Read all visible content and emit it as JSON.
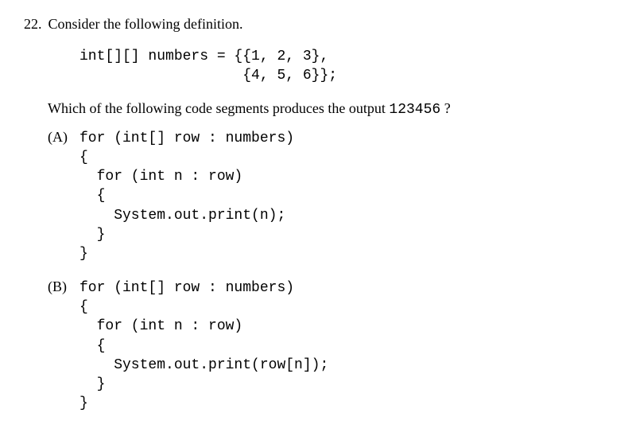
{
  "question": {
    "number": "22.",
    "stem": "Consider the following definition.",
    "code_line1": "int[][] numbers = {{1, 2, 3},",
    "code_line2": "                   {4, 5, 6}};",
    "prompt_pre": "Which of the following code segments produces the output  ",
    "prompt_code": "123456",
    "prompt_post": " ?"
  },
  "options": {
    "A": {
      "label": "(A)",
      "l1": "for (int[] row : numbers)",
      "l2": "{",
      "l3": "  for (int n : row)",
      "l4": "  {",
      "l5": "    System.out.print(n);",
      "l6": "  }",
      "l7": "}"
    },
    "B": {
      "label": "(B)",
      "l1": "for (int[] row : numbers)",
      "l2": "{",
      "l3": "  for (int n : row)",
      "l4": "  {",
      "l5": "    System.out.print(row[n]);",
      "l6": "  }",
      "l7": "}"
    }
  }
}
